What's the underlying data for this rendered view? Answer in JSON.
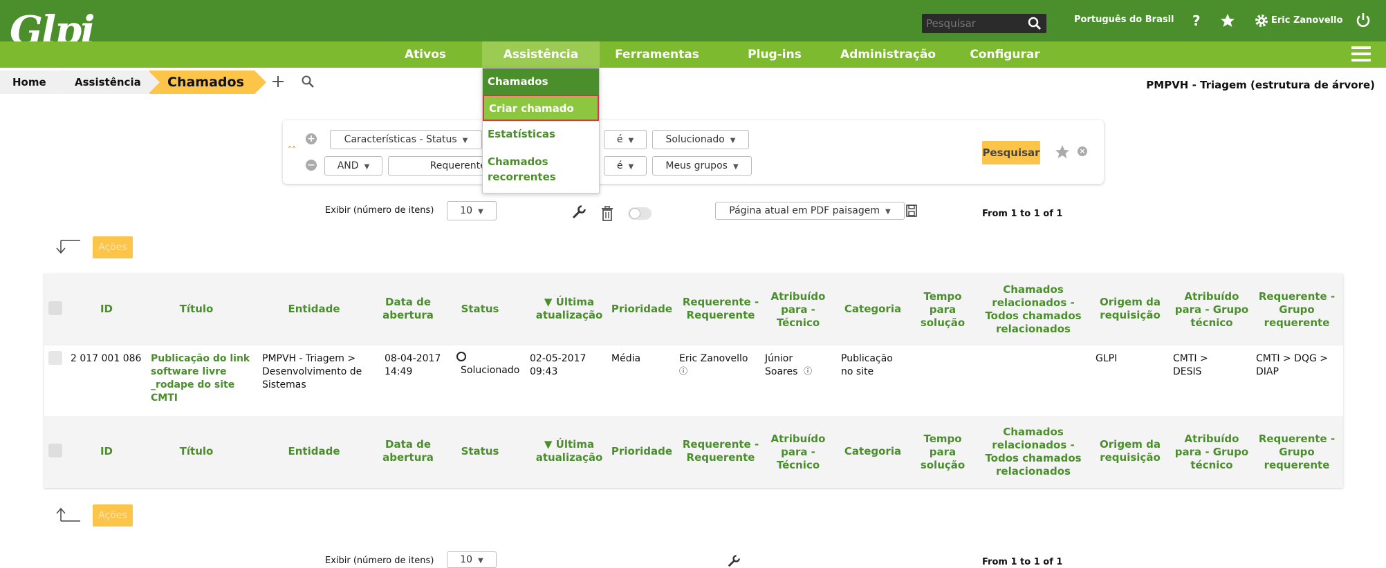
{
  "header": {
    "logo_text": "Glpi",
    "search_placeholder": "Pesquisar",
    "language": "Português do Brasil",
    "help_icon": "question-icon",
    "favorite_icon": "star-icon",
    "user_name": "Eric Zanovello",
    "settings_icon": "gear-icon",
    "logout_icon": "power-icon"
  },
  "nav": {
    "items": [
      "Ativos",
      "Assistência",
      "Ferramentas",
      "Plug-ins",
      "Administração",
      "Configurar"
    ],
    "active": "Assistência"
  },
  "dropdown": {
    "items": [
      "Chamados",
      "Criar chamado",
      "Estatísticas",
      "Chamados recorrentes"
    ]
  },
  "breadcrumb": {
    "items": [
      "Home",
      "Assistência",
      "Chamados"
    ],
    "entity": "PMPVH - Triagem (estrutura de árvore)"
  },
  "criteria": {
    "row1": {
      "field": "Características - Status",
      "operator": "é",
      "value": "Solucionado"
    },
    "row2": {
      "link": "AND",
      "field": "Requerente - Grupo",
      "operator": "é",
      "value": "Meus grupos"
    },
    "search_button": "Pesquisar"
  },
  "pager": {
    "display_label": "Exibir (número de itens)",
    "display_count": "10",
    "export_option": "Página atual em PDF paisagem",
    "range_text": "From 1 to 1 of 1"
  },
  "actions": {
    "label": "Ações"
  },
  "table": {
    "columns": [
      "ID",
      "Título",
      "Entidade",
      "Data de abertura",
      "Status",
      "▼ Última atualização",
      "Prioridade",
      "Requerente - Requerente",
      "Atribuído para - Técnico",
      "Categoria",
      "Tempo para solução",
      "Chamados relacionados - Todos chamados relacionados",
      "Origem da requisição",
      "Atribuído para - Grupo técnico",
      "Requerente - Grupo requerente"
    ],
    "rows": [
      {
        "id": "2 017 001 086",
        "title": "Publicação do link software livre _rodape do site CMTI",
        "entity": "PMPVH - Triagem > Desenvolvimento de Sistemas",
        "opened": "08-04-2017 14:49",
        "status": "Solucionado",
        "updated": "02-05-2017 09:43",
        "priority": "Média",
        "requester": "Eric Zanovello",
        "technician": "Júnior Soares",
        "category": "Publicação no site",
        "time_to_solve": "",
        "related": "",
        "origin": "GLPI",
        "tech_group": "CMTI > DESIS",
        "requester_group": "CMTI > DQG > DIAP"
      }
    ]
  }
}
